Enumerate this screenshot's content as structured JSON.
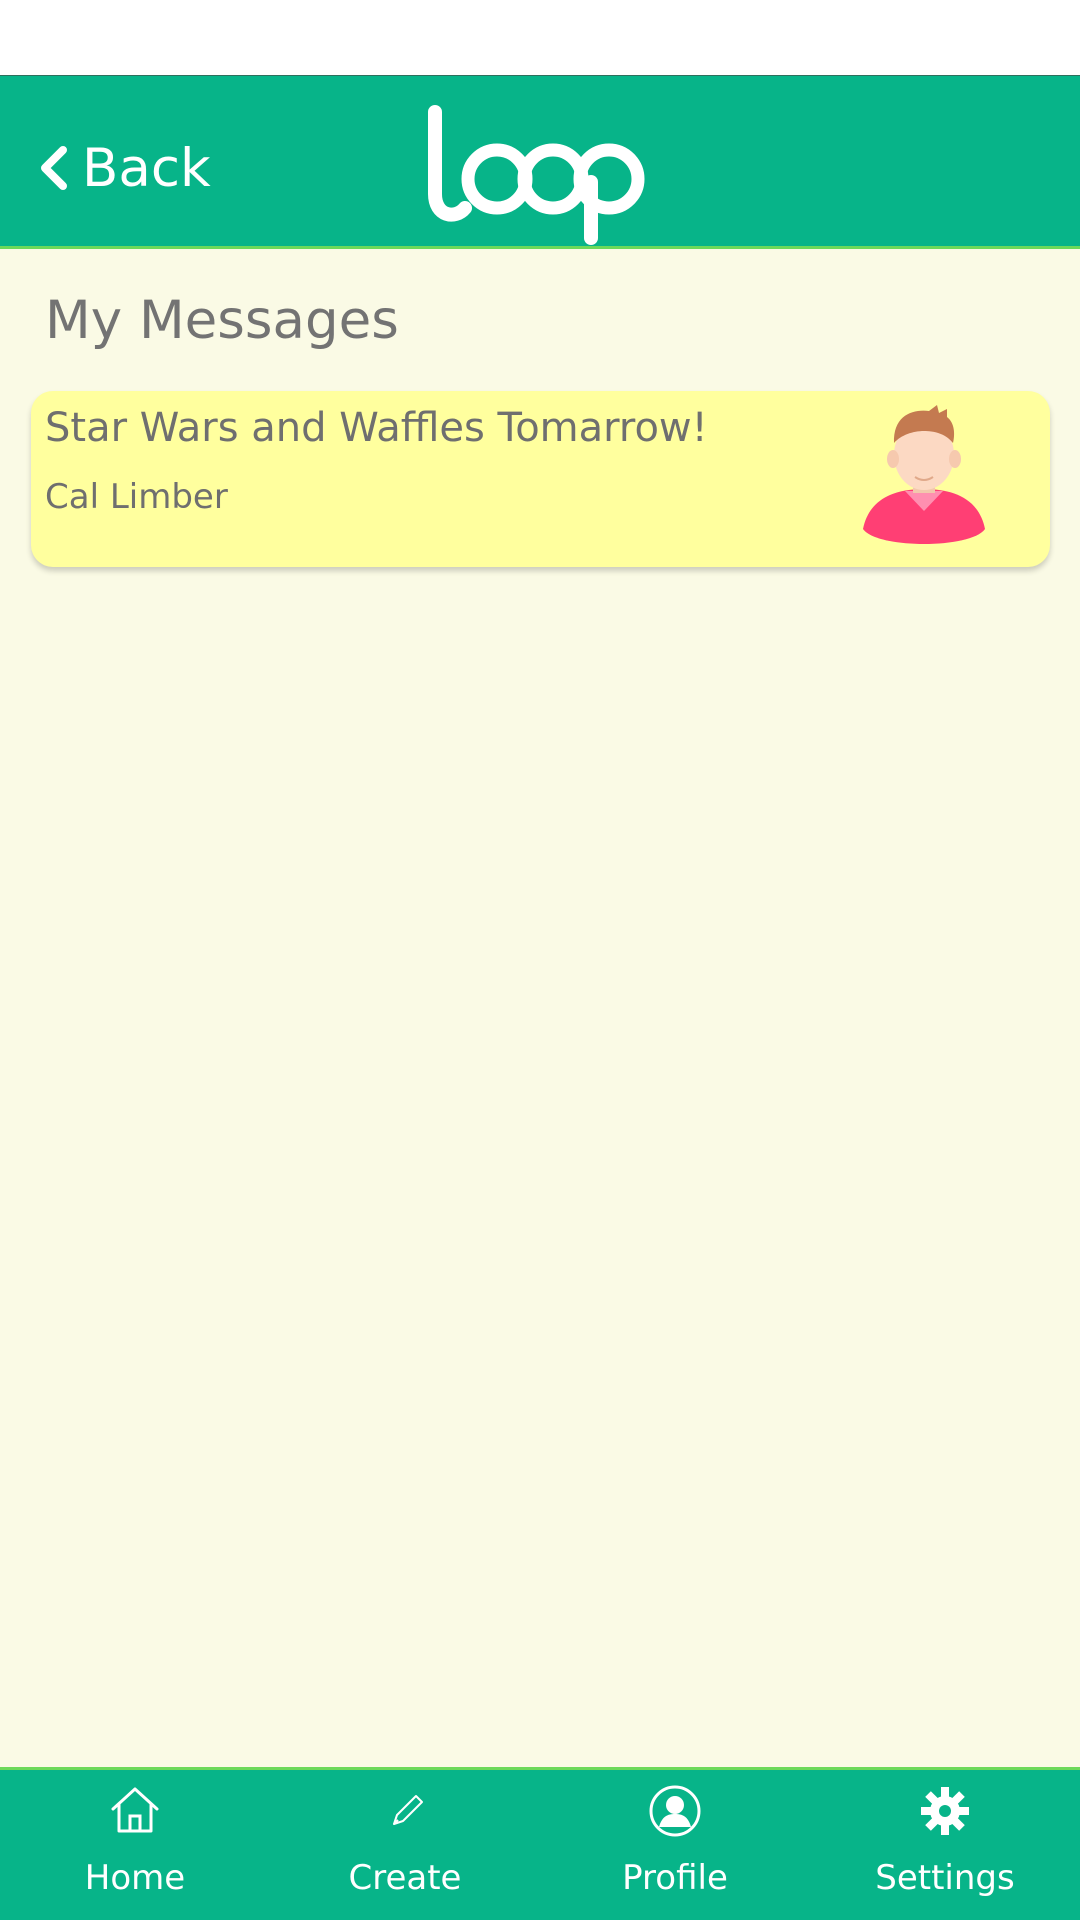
{
  "header": {
    "back_label": "Back",
    "logo_text": "loop",
    "back_icon": "chevron-left-icon",
    "background_color": "#07b489",
    "accent_line_color": "#6cd95a"
  },
  "main": {
    "title": "My Messages",
    "background_color": "#fafae5",
    "messages": [
      {
        "subject": "Star Wars and Waffles Tomarrow!",
        "sender": "Cal Limber",
        "avatar": "user-avatar-icon",
        "card_color": "#ffff9e"
      }
    ]
  },
  "tabbar": {
    "items": [
      {
        "label": "Home",
        "icon": "home-icon"
      },
      {
        "label": "Create",
        "icon": "pencil-icon"
      },
      {
        "label": "Profile",
        "icon": "profile-icon"
      },
      {
        "label": "Settings",
        "icon": "gear-icon"
      }
    ]
  }
}
